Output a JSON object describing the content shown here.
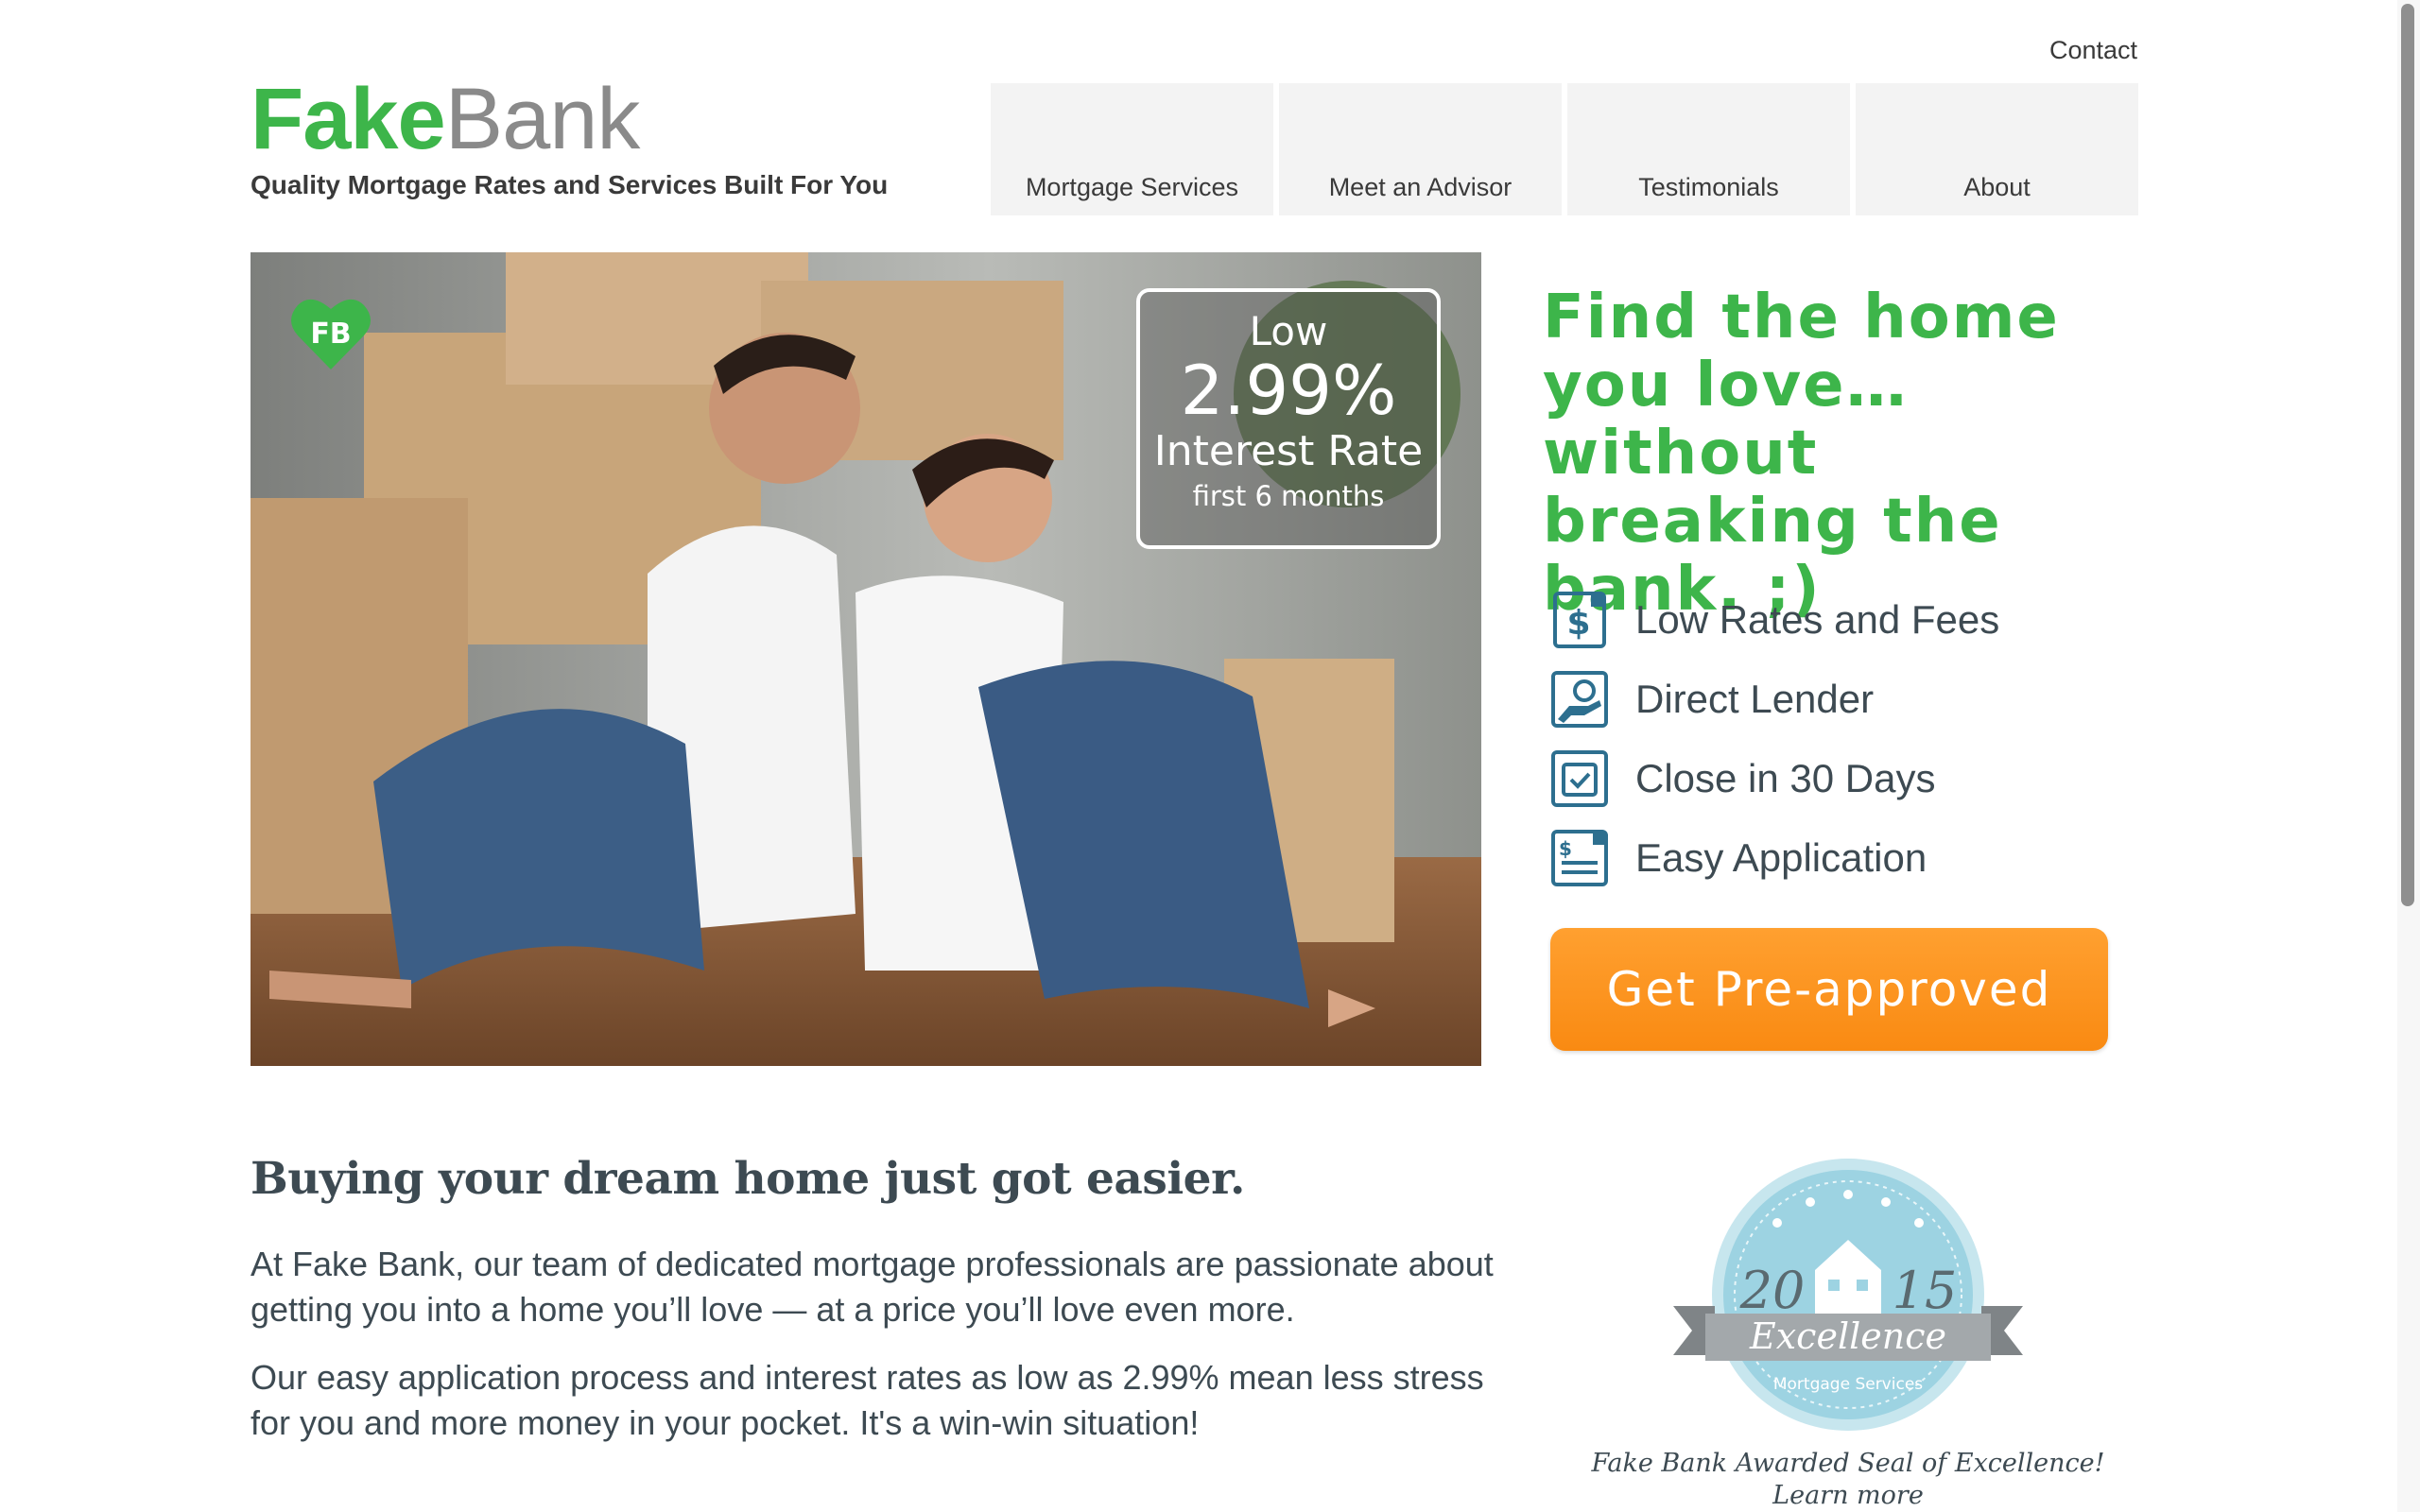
{
  "header": {
    "contact_label": "Contact",
    "logo": {
      "part1": "Fake",
      "part2": "Bank"
    },
    "tagline": "Quality Mortgage Rates and Services Built For You"
  },
  "nav": {
    "items": [
      {
        "label": "Mortgage Services"
      },
      {
        "label": "Meet an Advisor"
      },
      {
        "label": "Testimonials"
      },
      {
        "label": "About"
      }
    ]
  },
  "hero": {
    "badge_text": "FB",
    "rate_box": {
      "line1": "Low",
      "rate": "2.99%",
      "line3": "Interest Rate",
      "line4": "first 6 months"
    }
  },
  "promo": {
    "headline": "Find the home you love… without breaking the bank. ;)",
    "features": [
      {
        "icon": "dollar-icon",
        "label": "Low Rates and Fees"
      },
      {
        "icon": "hand-coin-icon",
        "label": "Direct Lender"
      },
      {
        "icon": "calendar-check-icon",
        "label": "Close in 30 Days"
      },
      {
        "icon": "application-form-icon",
        "label": "Easy Application"
      }
    ],
    "cta_label": "Get Pre-approved"
  },
  "content": {
    "heading": "Buying your dream home just got easier.",
    "paragraph1": "At Fake Bank, our team of dedicated mortgage professionals are passionate about getting you into a home you’ll love — at a price you’ll love even more.",
    "paragraph2": "Our easy application process and interest rates as low as 2.99% mean less stress for you and more money in your pocket. It's a win-win situation!"
  },
  "seal": {
    "year_left": "20",
    "year_right": "15",
    "ribbon_text": "Excellence",
    "sub_text": "Mortgage Services",
    "caption": "Fake Bank Awarded Seal of Excellence!",
    "learn_more": "Learn more"
  },
  "colors": {
    "brand_green": "#3db54a",
    "cta_orange": "#f98a12",
    "icon_blue": "#2d6f8f",
    "seal_blue": "#9dd3e2"
  }
}
